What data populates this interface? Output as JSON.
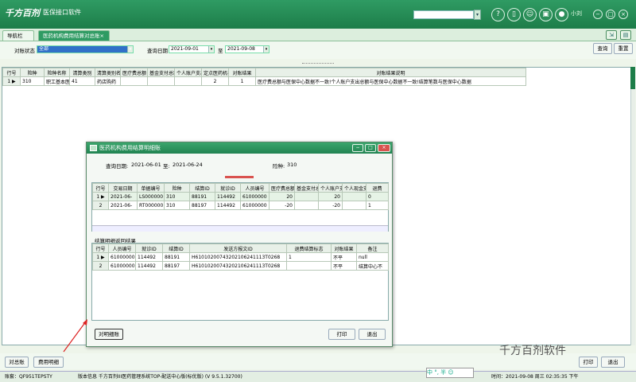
{
  "app": {
    "logo_text": "千方百剂",
    "title": "医保接口软件",
    "user": "小刘"
  },
  "top_icons": [
    "?",
    "▯",
    "☺",
    "▣",
    "●"
  ],
  "window_controls": [
    "−",
    "□",
    "×"
  ],
  "tabs": [
    {
      "label": "导航栏"
    },
    {
      "label": "医药机构费用结算对总账×"
    }
  ],
  "filter": {
    "status_label": "对账状态",
    "status_value": "全部",
    "date_label": "查询日期",
    "date_from": "2021-09-01",
    "date_to_label": "至",
    "date_to": "2021-09-08",
    "query_button": "查询",
    "reset_button": "重置"
  },
  "main_table": {
    "columns": [
      "行号",
      "险种",
      "险种名称",
      "清算类别",
      "清算类别名称",
      "医疗费总额",
      "基金支付总额",
      "个人账户支出",
      "定点医药机构结算笔数",
      "对账结果",
      "对账结果说明"
    ],
    "rows": [
      [
        "1",
        "310",
        "职工基本医",
        "41",
        "药店购药",
        "",
        "",
        "",
        "2",
        "1",
        "医疗费总额与医保中心数据不一致!个人账户支出总额与医保中心数据不一致!结算笔数与医保中心数据"
      ]
    ]
  },
  "bottom_buttons": {
    "summary_button": "对总账",
    "detail_button": "费用明细",
    "print_button": "打印",
    "exit_button": "退出"
  },
  "status": {
    "account": "账套：QF951TEPSTY",
    "version": "版本信息 千方百剂III医药管理系统TOP-配送中心版(标优版) (V 9.5.1.32700)",
    "time": "时间：2021-09-08 周三 02:35:35 下午",
    "ime": "中 °, 半 ☺"
  },
  "watermark": "千方百剂软件",
  "dialog": {
    "title": "医药机构费用结算明细账",
    "query_date_label": "查询日期:",
    "query_date_from": "2021-06-01",
    "query_date_to_label": "至:",
    "query_date_to": "2021-06-24",
    "insurance_label": "险种:",
    "insurance_value": "310",
    "detail_table": {
      "columns": [
        "行号",
        "交易日期",
        "单据编号",
        "险种",
        "结算ID",
        "就诊ID",
        "人员编号",
        "医疗费总额",
        "基金支付总额",
        "个人账户支出",
        "个人现金支出",
        "退费"
      ],
      "rows": [
        [
          "1",
          "2021-06-",
          "LS000000",
          "310",
          "88191",
          "114492",
          "61000000",
          "20",
          "",
          "20",
          "",
          "0"
        ],
        [
          "2",
          "2021-06-",
          "RT000000",
          "310",
          "88197",
          "114492",
          "61000000",
          "-20",
          "",
          "-20",
          "",
          "1"
        ]
      ]
    },
    "return_label": "结算明细返回结果",
    "return_table": {
      "columns": [
        "行号",
        "人员编号",
        "就诊ID",
        "结算ID",
        "发送方报文ID",
        "退费结算标志",
        "对账结果",
        "备注"
      ],
      "rows": [
        [
          "1",
          "61000000",
          "114492",
          "88191",
          "H61010200743202106241113T0268",
          "1",
          "不平",
          "null"
        ],
        [
          "2",
          "61000000",
          "114492",
          "88197",
          "H61010200743202106241113T0268",
          "",
          "不平",
          "结算中心不"
        ]
      ]
    },
    "detail_button": "对明细账",
    "print_button": "打印",
    "exit_button": "退出"
  }
}
